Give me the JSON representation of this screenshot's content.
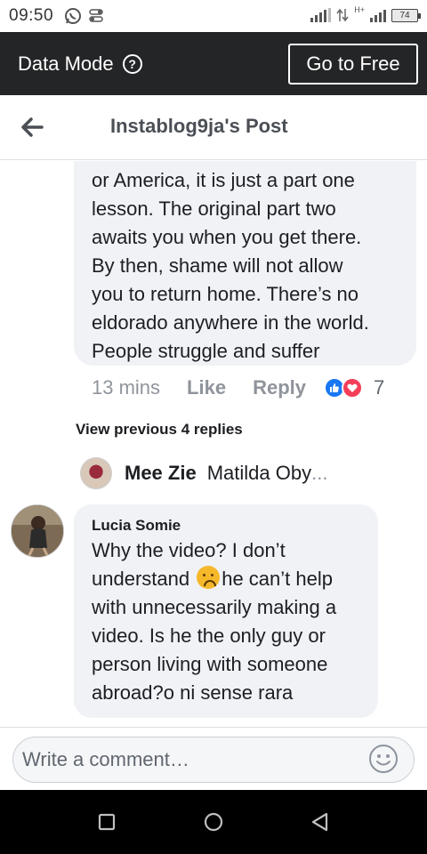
{
  "status_bar": {
    "time": "09:50",
    "battery": "74",
    "network": "H+"
  },
  "data_bar": {
    "title": "Data Mode",
    "help_icon": "help-circle-icon",
    "go_free_label": "Go to Free"
  },
  "header": {
    "back_icon": "back-arrow-icon",
    "title": "Instablog9ja's Post"
  },
  "comment_1": {
    "lines": [
      "or America, it is just a part one",
      "lesson. The original part two",
      "awaits you when you get there.",
      "By then, shame will not allow",
      "you to return home. There’s no",
      "eldorado anywhere in the world.",
      "People struggle and suffer"
    ],
    "time": "13 mins",
    "like_label": "Like",
    "reply_label": "Reply",
    "reaction_count": "7",
    "reaction_icons": [
      "like-reaction-icon",
      "love-reaction-icon"
    ]
  },
  "view_previous": "View previous 4 replies",
  "reply_preview": {
    "name": "Mee Zie",
    "text": "Matilda Oby",
    "ellipsis": "..."
  },
  "comment_2": {
    "author": "Lucia Somie",
    "line1": "Why the video? I don’t",
    "line2_before": "understand ",
    "line2_after": "he can’t help",
    "line3": "with unnecessarily making a",
    "line4": "video. Is he the only guy or",
    "line5": "person living with someone",
    "line6": "abroad?o ni sense rara",
    "emoji": "frowning-face-emoji"
  },
  "comment_input": {
    "placeholder": "Write a comment…",
    "emoji_icon": "smiley-icon"
  },
  "nav": {
    "recent_icon": "recent-apps-icon",
    "home_icon": "home-icon",
    "back_icon": "back-triangle-icon"
  },
  "colors": {
    "data_bar_bg": "#242526",
    "bubble_bg": "#f0f2f5",
    "meta_text": "#90949c",
    "like_blue": "#1877f2",
    "love_red": "#f33e58"
  }
}
